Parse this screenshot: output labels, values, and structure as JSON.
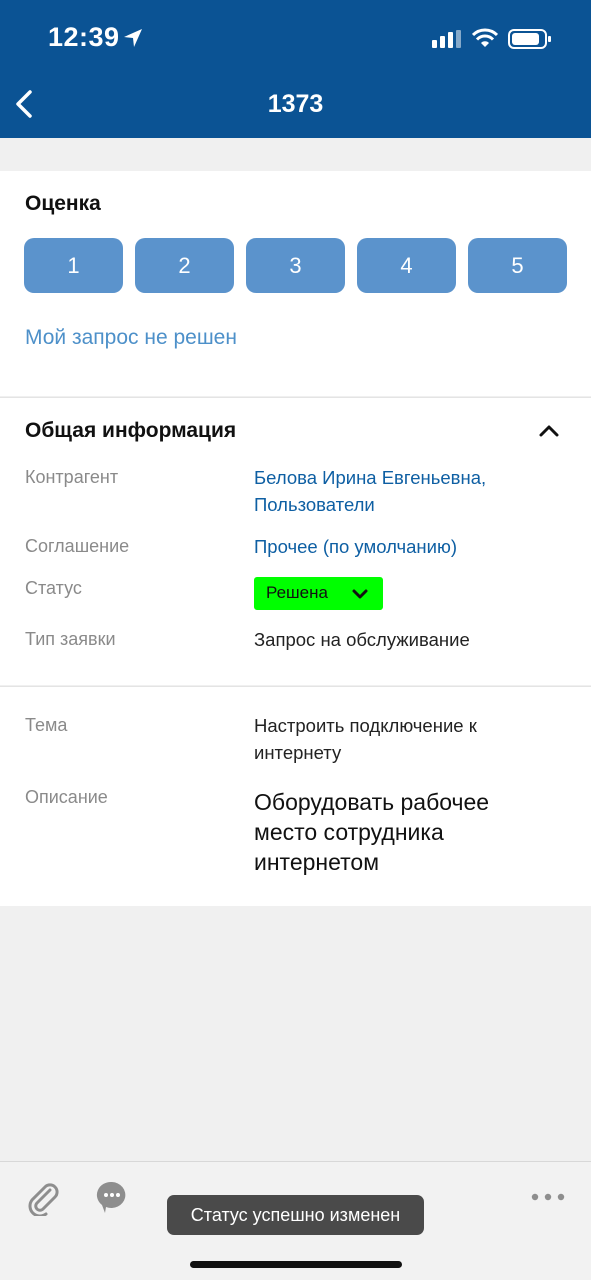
{
  "status_bar": {
    "time": "12:39"
  },
  "header": {
    "title": "1373"
  },
  "rating": {
    "title": "Оценка",
    "buttons": [
      "1",
      "2",
      "3",
      "4",
      "5"
    ],
    "unsolved_link": "Мой запрос не решен"
  },
  "general_info": {
    "title": "Общая информация",
    "counterparty": {
      "label": "Контрагент",
      "value_line1": "Белова Ирина Евгеньевна,",
      "value_line2": "Пользователи"
    },
    "agreement": {
      "label": "Соглашение",
      "value": "Прочее (по умолчанию)"
    },
    "status": {
      "label": "Статус",
      "value": "Решена",
      "color": "#00ff00"
    },
    "request_type": {
      "label": "Тип заявки",
      "value": "Запрос на обслуживание"
    }
  },
  "details": {
    "topic": {
      "label": "Тема",
      "value_line1": "Настроить подключение к",
      "value_line2": "интернету"
    },
    "description": {
      "label": "Описание",
      "value_line1": "Оборудовать рабочее",
      "value_line2": "место сотрудника",
      "value_line3": "интернетом"
    }
  },
  "toast": {
    "text": "Статус успешно изменен"
  },
  "icons": {
    "back": "chevron-left-icon",
    "attach": "paperclip-icon",
    "chat": "chat-bubble-icon",
    "more": "more-dots-icon",
    "collapse": "chevron-up-icon"
  },
  "colors": {
    "header_bg": "#0b5394",
    "rating_button": "#5b93cc",
    "link": "#0e5fa3",
    "status_resolved": "#00ff00"
  }
}
